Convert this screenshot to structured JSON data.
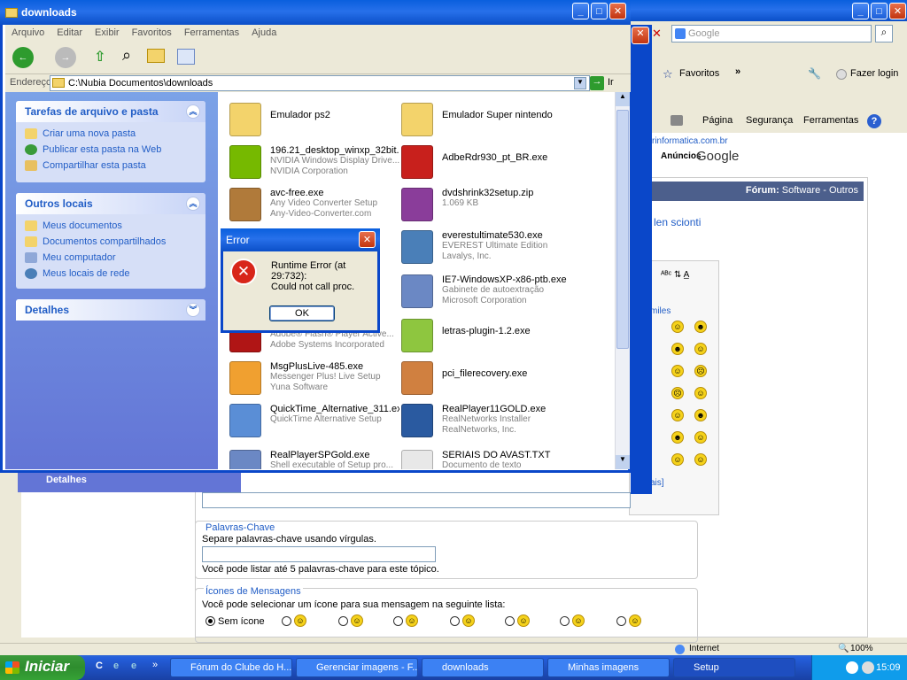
{
  "ie": {
    "search_placeholder": "Google",
    "favorites": "Favoritos",
    "login": "Fazer login",
    "page": "Página",
    "security": "Segurança",
    "tools": "Ferramentas",
    "site_url": "rinformatica.com.br",
    "ads": "Anúncios",
    "ads_brand": "Google",
    "forum_label": "Fórum:",
    "forum_path": "Software - Outros",
    "partial_text": "len scionti",
    "smiles_label": "miles",
    "mais_label": "ais]",
    "detalhes_partial": "Detalhes",
    "keywords_legend": "Palavras-Chave",
    "keywords_hint": "Separe palavras-chave usando vírgulas.",
    "keywords_limit": "Você pode listar até 5 palavras-chave para este tópico.",
    "icons_legend": "Ícones de Mensagens",
    "icons_hint": "Você pode selecionar um ícone para sua mensagem na seguinte lista:",
    "no_icon": "Sem ícone",
    "status_zone": "Internet",
    "zoom": "100%"
  },
  "explorer": {
    "title": "downloads",
    "menu": [
      "Arquivo",
      "Editar",
      "Exibir",
      "Favoritos",
      "Ferramentas",
      "Ajuda"
    ],
    "address_label": "Endereço",
    "address": "C:\\Nubia Documentos\\downloads",
    "go": "Ir",
    "tasks_title": "Tarefas de arquivo e pasta",
    "tasks": [
      "Criar uma nova pasta",
      "Publicar esta pasta na Web",
      "Compartilhar esta pasta"
    ],
    "places_title": "Outros locais",
    "places": [
      "Meus documentos",
      "Documentos compartilhados",
      "Meu computador",
      "Meus locais de rede"
    ],
    "details_title": "Detalhes",
    "files": [
      {
        "name": "Emulador ps2",
        "l1": "",
        "l2": "",
        "color": "#f3d36b"
      },
      {
        "name": "Emulador Super nintendo",
        "l1": "",
        "l2": "",
        "color": "#f3d36b"
      },
      {
        "name": "196.21_desktop_winxp_32bit...",
        "l1": "NVIDIA Windows Display Drive...",
        "l2": "NVIDIA Corporation",
        "color": "#76b900"
      },
      {
        "name": "AdbeRdr930_pt_BR.exe",
        "l1": "",
        "l2": "",
        "color": "#c8201c"
      },
      {
        "name": "avc-free.exe",
        "l1": "Any Video Converter Setup",
        "l2": "Any-Video-Converter.com",
        "color": "#b07a3a"
      },
      {
        "name": "dvdshrink32setup.zip",
        "l1": "1.069 KB",
        "l2": "",
        "color": "#8a3d9a"
      },
      {
        "name": "",
        "l1": "",
        "l2": "",
        "color": "#ffffff"
      },
      {
        "name": "everestultimate530.exe",
        "l1": "EVEREST Ultimate Edition",
        "l2": "Lavalys, Inc.",
        "color": "#4a7fb8"
      },
      {
        "name": "",
        "l1": "",
        "l2": "",
        "color": "#ffffff"
      },
      {
        "name": "IE7-WindowsXP-x86-ptb.exe",
        "l1": "Gabinete de autoextração",
        "l2": "Microsoft Corporation",
        "color": "#6b88c4"
      },
      {
        "name": "",
        "l1": "Adobe® Flash® Player Active...",
        "l2": "Adobe Systems Incorporated",
        "color": "#b01515"
      },
      {
        "name": "letras-plugin-1.2.exe",
        "l1": "",
        "l2": "",
        "color": "#8ec63f"
      },
      {
        "name": "MsgPlusLive-485.exe",
        "l1": "Messenger Plus! Live Setup",
        "l2": "Yuna Software",
        "color": "#f0a030"
      },
      {
        "name": "pci_filerecovery.exe",
        "l1": "",
        "l2": "",
        "color": "#d08040"
      },
      {
        "name": "QuickTime_Alternative_311.exe",
        "l1": "QuickTime Alternative Setup",
        "l2": "",
        "color": "#5a8ed6"
      },
      {
        "name": "RealPlayer11GOLD.exe",
        "l1": "RealNetworks Installer",
        "l2": "RealNetworks, Inc.",
        "color": "#2a5aa0"
      },
      {
        "name": "RealPlayerSPGold.exe",
        "l1": "Shell executable of Setup pro...",
        "l2": "",
        "color": "#6b88c4"
      },
      {
        "name": "SERIAIS DO AVAST.TXT",
        "l1": "Documento de texto",
        "l2": "",
        "color": "#e8e8e8"
      }
    ]
  },
  "dialog": {
    "title": "Error",
    "message": "Runtime Error (at 29:732):",
    "detail": "Could not call proc.",
    "ok": "OK"
  },
  "taskbar": {
    "start": "Iniciar",
    "buttons": [
      "Fórum do Clube do H...",
      "Gerenciar imagens - F...",
      "downloads",
      "Minhas imagens",
      "Setup"
    ],
    "lang": "PT",
    "time": "15:09"
  }
}
